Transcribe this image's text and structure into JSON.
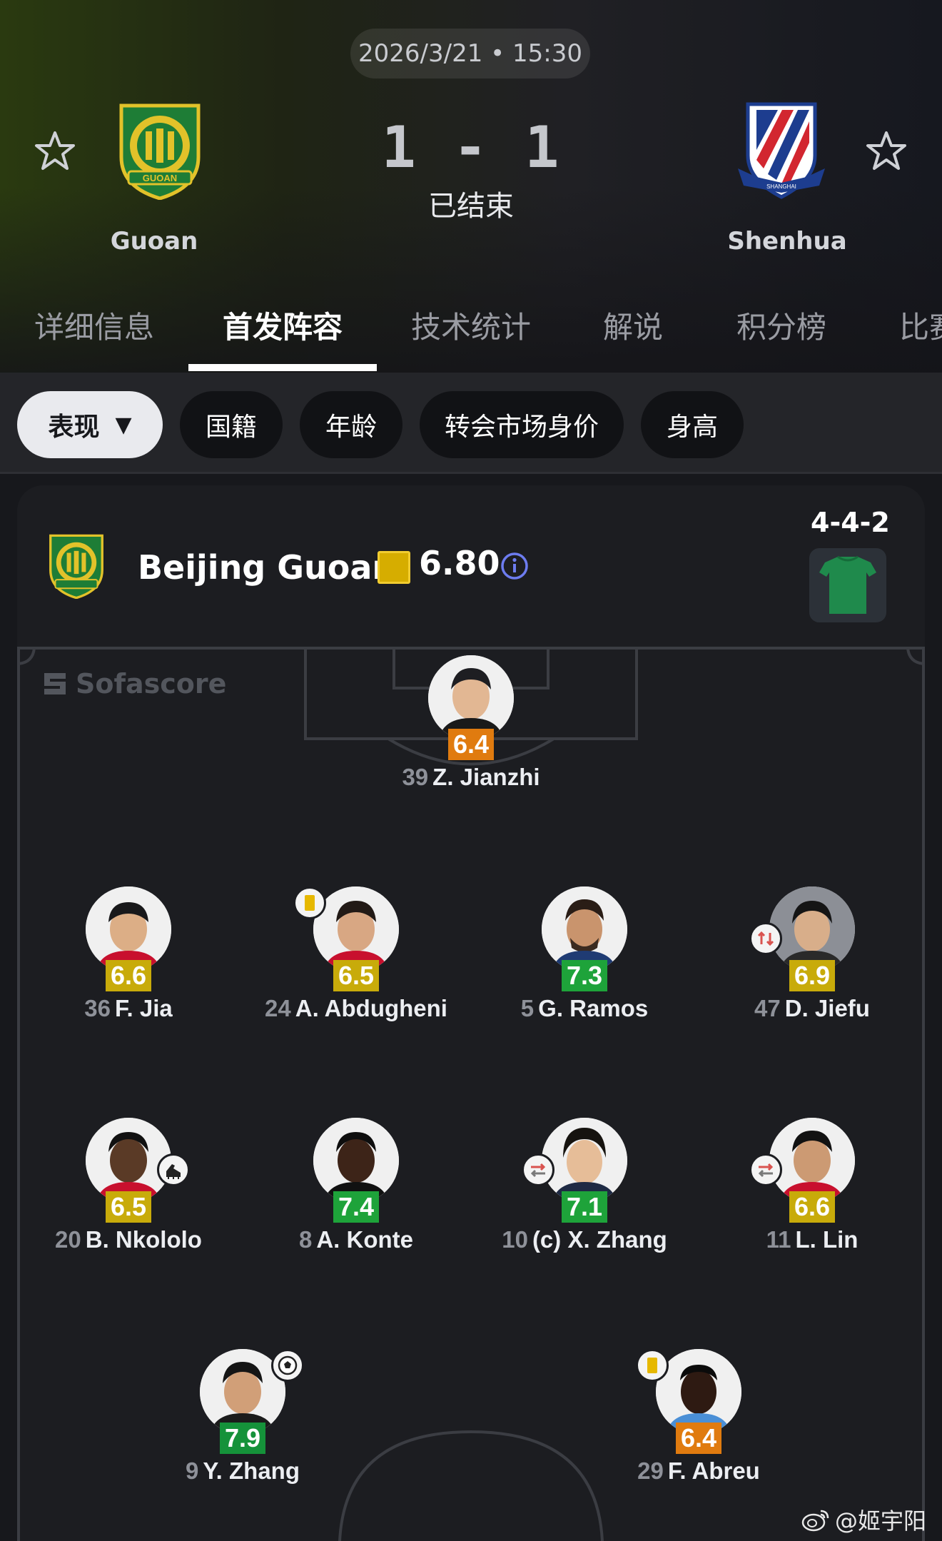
{
  "match": {
    "datetime": "2026/3/21 • 15:30",
    "score": "1 - 1",
    "status": "已结束",
    "home_team": "Guoan",
    "away_team": "Shenhua"
  },
  "tabs": [
    {
      "label": "详细信息",
      "active": false
    },
    {
      "label": "首发阵容",
      "active": true
    },
    {
      "label": "技术统计",
      "active": false
    },
    {
      "label": "解说",
      "active": false
    },
    {
      "label": "积分榜",
      "active": false
    },
    {
      "label": "比赛",
      "active": false
    }
  ],
  "filters": [
    {
      "label": "表现",
      "selected": true
    },
    {
      "label": "国籍",
      "selected": false
    },
    {
      "label": "年龄",
      "selected": false
    },
    {
      "label": "转会市场身价",
      "selected": false
    },
    {
      "label": "身高",
      "selected": false
    }
  ],
  "lineup": {
    "team": "Beijing Guoan",
    "average_rating": "6.80",
    "formation": "4-4-2",
    "watermark": "Sofascore",
    "kit_color": "#1f8a4c",
    "rating_swatch_color": "#d6ad00"
  },
  "players": [
    {
      "number": "39",
      "name": "Z. Jianzhi",
      "rating": "6.4",
      "rating_color": "orange",
      "badge": null
    },
    {
      "number": "36",
      "name": "F. Jia",
      "rating": "6.6",
      "rating_color": "yellow",
      "badge": null
    },
    {
      "number": "24",
      "name": "A. Abdugheni",
      "rating": "6.5",
      "rating_color": "yellow",
      "badge": "yellow-card-icon"
    },
    {
      "number": "5",
      "name": "G. Ramos",
      "rating": "7.3",
      "rating_color": "lgreen",
      "badge": null
    },
    {
      "number": "47",
      "name": "D. Jiefu",
      "rating": "6.9",
      "rating_color": "yellow",
      "badge": "substitution-in-icon"
    },
    {
      "number": "20",
      "name": "B. Nkololo",
      "rating": "6.5",
      "rating_color": "yellow",
      "badge": "boot-assist-icon"
    },
    {
      "number": "8",
      "name": "A. Konte",
      "rating": "7.4",
      "rating_color": "lgreen",
      "badge": null
    },
    {
      "number": "10",
      "name": "(c) X. Zhang",
      "rating": "7.1",
      "rating_color": "lgreen",
      "badge": "substitution-out-icon"
    },
    {
      "number": "11",
      "name": "L. Lin",
      "rating": "6.6",
      "rating_color": "yellow",
      "badge": "substitution-out-icon"
    },
    {
      "number": "9",
      "name": "Y. Zhang",
      "rating": "7.9",
      "rating_color": "green",
      "badge": "goal-ball-icon"
    },
    {
      "number": "29",
      "name": "F. Abreu",
      "rating": "6.4",
      "rating_color": "orange",
      "badge": "yellow-card-icon"
    }
  ],
  "footer": {
    "watermark": "@姬宇阳"
  }
}
